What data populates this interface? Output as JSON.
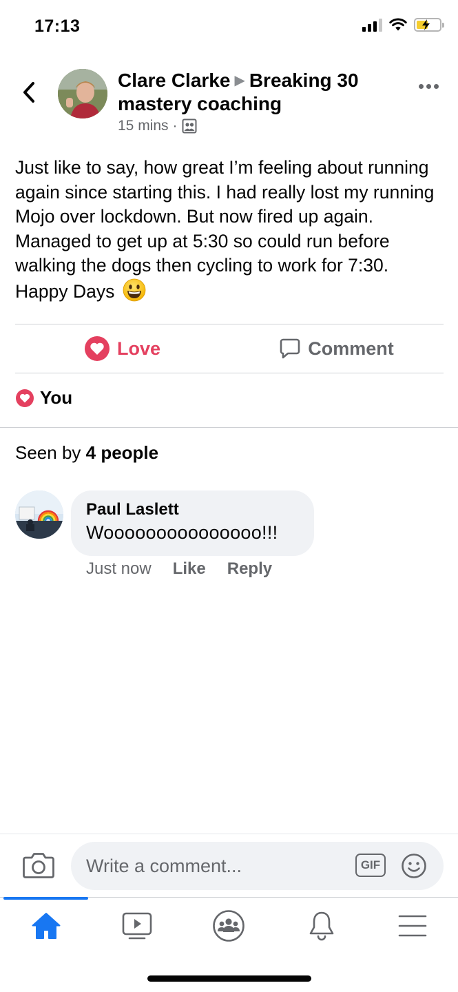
{
  "status_bar": {
    "time": "17:13"
  },
  "post": {
    "author": "Clare Clarke",
    "group": "Breaking 30 mastery coaching",
    "timestamp": "15 mins",
    "separator": "·",
    "audience_icon": "group-audience-icon",
    "body": "Just like to say, how great I’m feeling about running again since starting this. I had really lost my running Mojo over lockdown. But now fired up again. Managed to get up at 5:30 so could run before walking the dogs then cycling to work for 7:30. Happy Days",
    "emoji": "smiley-emoji"
  },
  "actions": {
    "love_label": "Love",
    "comment_label": "Comment"
  },
  "reactions": {
    "label": "You"
  },
  "seen_by": {
    "prefix": "Seen by",
    "count_text": "4 people"
  },
  "comments": [
    {
      "author": "Paul Laslett",
      "text": "Wooooooooooooooo!!!",
      "time": "Just now",
      "like_label": "Like",
      "reply_label": "Reply"
    }
  ],
  "composer": {
    "placeholder": "Write a comment...",
    "gif_label": "GIF"
  },
  "tab_bar": {
    "active_tab": "home",
    "tabs": [
      "home-icon",
      "watch-icon",
      "groups-icon",
      "notifications-icon",
      "menu-icon"
    ]
  },
  "colors": {
    "love": "#e4405f",
    "accent": "#1877f2",
    "secondary_text": "#65676b",
    "bubble": "#f0f2f5"
  }
}
